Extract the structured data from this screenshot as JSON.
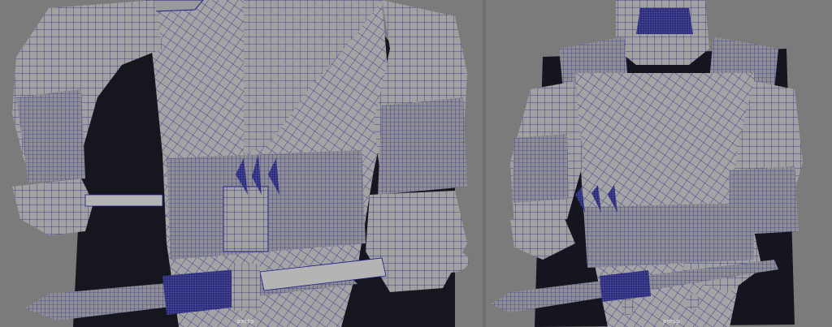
{
  "viewports": [
    {
      "camera_label": "persp"
    },
    {
      "camera_label": "persp"
    }
  ],
  "colors": {
    "background": "#7b7b7b",
    "mesh_fill": "#9c9c9c",
    "wireframe": "#1c1c86",
    "backdrop": "#1a1a26"
  }
}
